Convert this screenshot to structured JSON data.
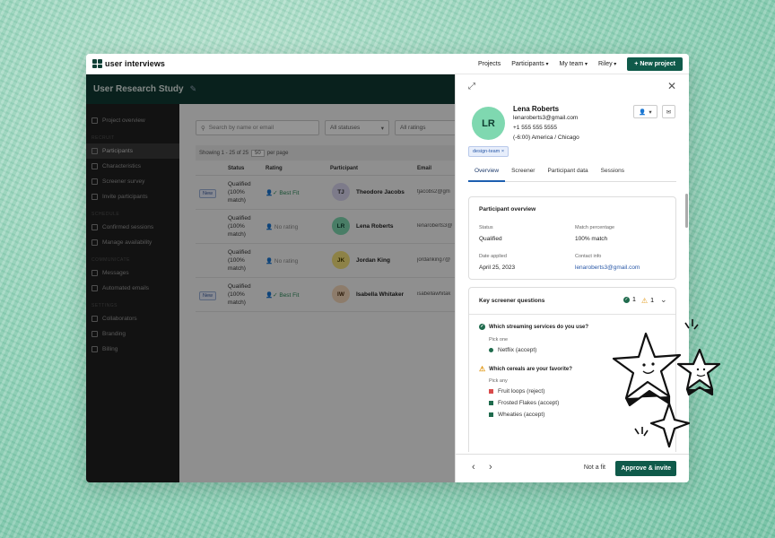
{
  "topnav": {
    "logo_text": "user interviews",
    "links": [
      "Projects",
      "Participants",
      "My team",
      "Riley"
    ],
    "new_project": "+ New project"
  },
  "study": {
    "title": "User Research Study"
  },
  "sidebar": {
    "overview": "Project overview",
    "sections": [
      {
        "head": "RECRUIT",
        "items": [
          "Participants",
          "Characteristics",
          "Screener survey",
          "Invite participants"
        ]
      },
      {
        "head": "SCHEDULE",
        "items": [
          "Confirmed sessions",
          "Manage availability"
        ]
      },
      {
        "head": "COMMUNICATE",
        "items": [
          "Messages",
          "Automated emails"
        ]
      },
      {
        "head": "SETTINGS",
        "items": [
          "Collaborators",
          "Branding",
          "Billing"
        ]
      }
    ]
  },
  "main": {
    "search_placeholder": "Search by name or email",
    "status_filter": "All statuses",
    "rating_filter": "All ratings",
    "showing": "Showing 1 - 25 of 25",
    "per_page_value": "50",
    "per_page_label": "per page",
    "columns": [
      "Status",
      "Rating",
      "Participant",
      "Email"
    ],
    "rows": [
      {
        "tag": "New",
        "status": "Qualified (100% match)",
        "rating": "Best Fit",
        "initials": "TJ",
        "name": "Theodore Jacobs",
        "email": "tjacobs2@gm",
        "avatar_color": "#d8d4ee"
      },
      {
        "tag": "",
        "status": "Qualified (100% match)",
        "rating": "No rating",
        "initials": "LR",
        "name": "Lena Roberts",
        "email": "lenaroberts3@",
        "avatar_color": "#7fd8b0"
      },
      {
        "tag": "",
        "status": "Qualified (100% match)",
        "rating": "No rating",
        "initials": "JK",
        "name": "Jordan King",
        "email": "jordanking7@",
        "avatar_color": "#f3e07a"
      },
      {
        "tag": "New",
        "status": "Qualified (100% match)",
        "rating": "Best Fit",
        "initials": "IW",
        "name": "Isabella Whitaker",
        "email": "isabellawhitak",
        "avatar_color": "#f3d6b8"
      }
    ]
  },
  "panel": {
    "initials": "LR",
    "name": "Lena Roberts",
    "email": "lenaroberts3@gmail.com",
    "phone": "+1 555 555 5555",
    "timezone": "(-6:00) America / Chicago",
    "tag": "design-team",
    "tabs": [
      "Overview",
      "Screener",
      "Participant data",
      "Sessions"
    ],
    "overview": {
      "title": "Participant overview",
      "status_label": "Status",
      "status_value": "Qualified",
      "match_label": "Match percentage",
      "match_value": "100% match",
      "date_label": "Date applied",
      "date_value": "April 25, 2023",
      "contact_label": "Contact info",
      "contact_value": "lenaroberts3@gmail.com"
    },
    "screener": {
      "title": "Key screener questions",
      "pass_count": "1",
      "warn_count": "1",
      "q1": "Which streaming services do you use?",
      "q1_pick": "Pick one",
      "q1_answers": [
        "Netflix (accept)"
      ],
      "q2": "Which cereals are your favorite?",
      "q2_pick": "Pick any",
      "q2_answers": [
        "Fruit loops (reject)",
        "Frosted Flakes (accept)",
        "Wheaties (accept)"
      ]
    },
    "footer": {
      "not_fit": "Not a fit",
      "approve": "Approve & invite"
    }
  },
  "colors": {
    "brand": "#0f5a4a",
    "header": "#113a33",
    "link": "#2b5aa8",
    "accept": "#2e8a5a",
    "reject": "#d94b4b"
  }
}
